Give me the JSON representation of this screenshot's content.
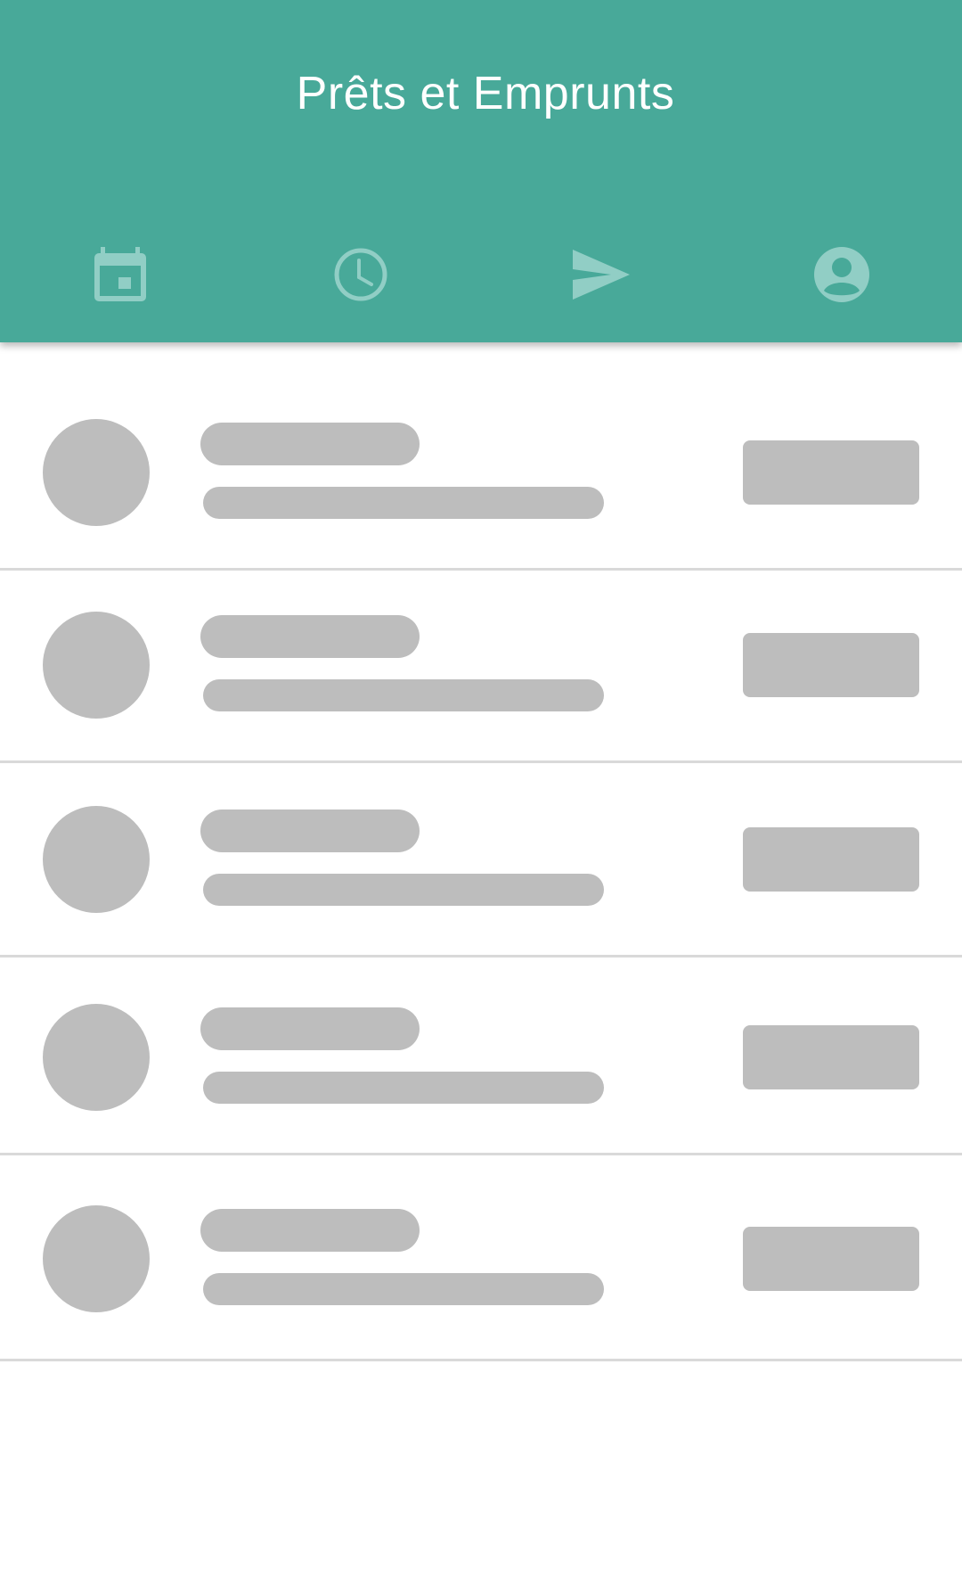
{
  "app": {
    "title": "Prêts et Emprunts"
  },
  "colors": {
    "primary": "#48A999",
    "tab_icon": "#91CEC5",
    "skeleton": "#BDBDBD",
    "divider": "#D9D9D9",
    "background": "#FFFFFF"
  },
  "tabs": [
    {
      "icon": "calendar-event-icon"
    },
    {
      "icon": "clock-icon"
    },
    {
      "icon": "send-icon"
    },
    {
      "icon": "account-circle-icon"
    }
  ],
  "list": {
    "state": "loading-placeholder",
    "rows": [
      {
        "placeholder": true
      },
      {
        "placeholder": true
      },
      {
        "placeholder": true
      },
      {
        "placeholder": true
      },
      {
        "placeholder": true
      }
    ]
  }
}
